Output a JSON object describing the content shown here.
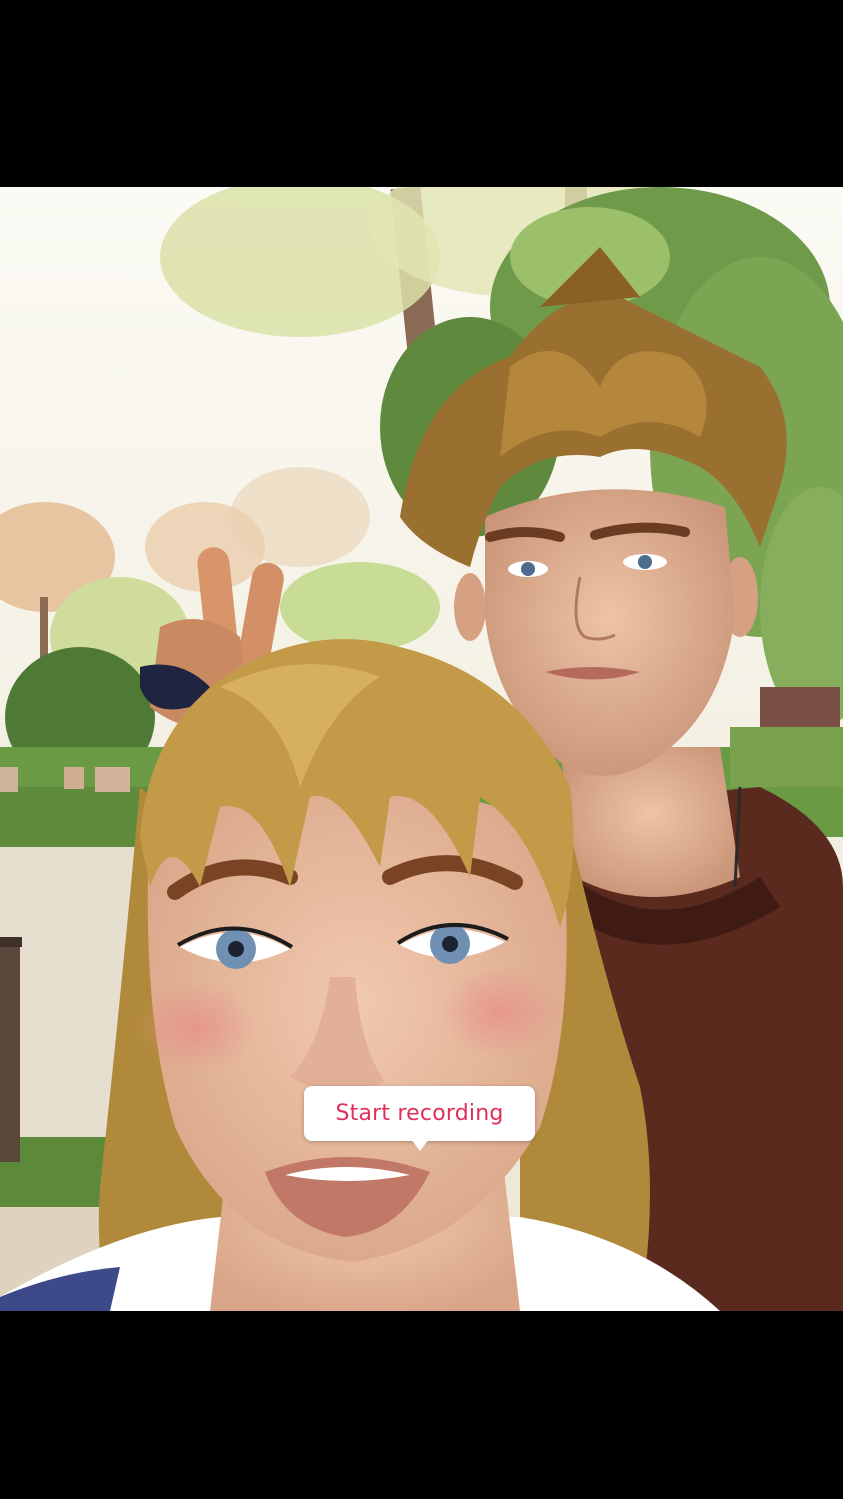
{
  "screen": {
    "background_color": "#000000"
  },
  "camera": {
    "scene_description_icon": "avatar-selfie-scene"
  },
  "recording_tooltip": {
    "label": "Start recording",
    "text_color": "#e0305a",
    "background_color": "#ffffff"
  }
}
